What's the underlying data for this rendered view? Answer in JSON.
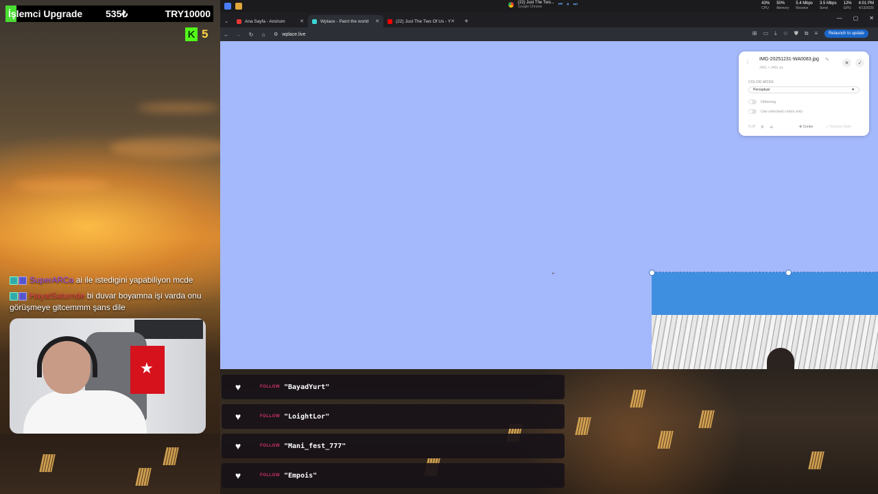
{
  "overlay": {
    "goal": {
      "title": "İşlemci Upgrade",
      "current": "535₺",
      "target": "TRY10000",
      "progress_percent": 5.35
    },
    "kick": {
      "letter": "K",
      "viewers": "5"
    },
    "chat": [
      {
        "user": "SuperARCa",
        "message": " ai ile istedigini yapabiliyon mcde"
      },
      {
        "user": "HayatSaturnde",
        "message": " bi duvar boyamna işi varda onu görüşmeye gitcemmm şans dile"
      }
    ],
    "follows": [
      {
        "tag": "FOLLOW",
        "name": "\"BayadYurt\""
      },
      {
        "tag": "FOLLOW",
        "name": "\"LoightLor\""
      },
      {
        "tag": "FOLLOW",
        "name": "\"Mani_fest_777\""
      },
      {
        "tag": "FOLLOW",
        "name": "\"Empois\""
      }
    ],
    "flag_star": "★"
  },
  "taskbar": {
    "media_title": "(22) Just The Two...",
    "media_sub": "Google Chrome",
    "stats": [
      {
        "value": "43%",
        "label": "CPU"
      },
      {
        "value": "50%",
        "label": "Memory"
      },
      {
        "value": "5.4 Mbps",
        "label": "Receive"
      },
      {
        "value": "3.5 Mbps",
        "label": "Send"
      },
      {
        "value": "12%",
        "label": "GPU"
      },
      {
        "value": "4:01 PM",
        "label": "4/13/2026"
      }
    ]
  },
  "browser": {
    "tabs": [
      {
        "title": "Ana Sayfa - Anizium",
        "color": "#e53935"
      },
      {
        "title": "Wplace - Paint the world",
        "color": "#3dd3d3"
      },
      {
        "title": "(22) Just The Two Of Us - Y",
        "color": "#ff0000"
      }
    ],
    "url": "wplace.live",
    "relaunch_label": "Relaunch to update"
  },
  "upload_panel": {
    "file_name": "IMG-20251231-WA0083.jpg",
    "dimensions": "3461 × 3461 px",
    "color_mode_label": "COLOR MODE",
    "color_mode_value": "Perceptual",
    "dithering_label": "Dithering",
    "unlocked_label": "Use unlocked colors only",
    "flip_label": "FLIP",
    "center_label": "Center",
    "restore_label": "Restore Ratio"
  },
  "colors": {
    "canvas": "#a4b9fb",
    "accent": "#1a66c9",
    "goal_fill": "#4ade32",
    "kick": "#53fc18"
  }
}
